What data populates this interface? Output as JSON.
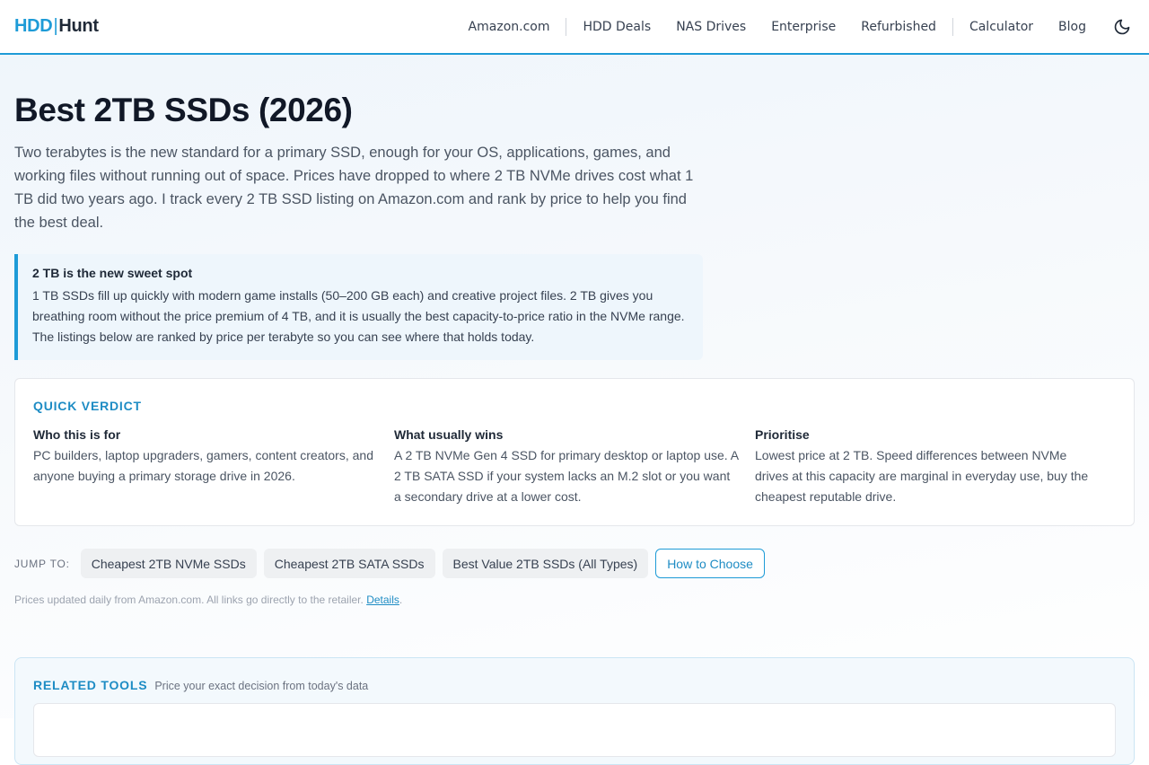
{
  "header": {
    "logo_part1": "HDD",
    "logo_sep": "|",
    "logo_part2": "Hunt",
    "nav": {
      "amazon": "Amazon.com",
      "hdd_deals": "HDD Deals",
      "nas_drives": "NAS Drives",
      "enterprise": "Enterprise",
      "refurbished": "Refurbished",
      "calculator": "Calculator",
      "blog": "Blog"
    },
    "theme_icon": "moon-icon"
  },
  "page": {
    "title": "Best 2TB SSDs (2026)",
    "intro": "Two terabytes is the new standard for a primary SSD, enough for your OS, applications, games, and working files without running out of space. Prices have dropped to where 2 TB NVMe drives cost what 1 TB did two years ago. I track every 2 TB SSD listing on Amazon.com and rank by price to help you find the best deal."
  },
  "callout": {
    "title": "2 TB is the new sweet spot",
    "body": "1 TB SSDs fill up quickly with modern game installs (50–200 GB each) and creative project files. 2 TB gives you breathing room without the price premium of 4 TB, and it is usually the best capacity-to-price ratio in the NVMe range. The listings below are ranked by price per terabyte so you can see where that holds today."
  },
  "verdict": {
    "heading": "QUICK VERDICT",
    "cols": [
      {
        "title": "Who this is for",
        "body": "PC builders, laptop upgraders, gamers, content creators, and anyone buying a primary storage drive in 2026."
      },
      {
        "title": "What usually wins",
        "body": "A 2 TB NVMe Gen 4 SSD for primary desktop or laptop use. A 2 TB SATA SSD if your system lacks an M.2 slot or you want a secondary drive at a lower cost."
      },
      {
        "title": "Prioritise",
        "body": "Lowest price at 2 TB. Speed differences between NVMe drives at this capacity are marginal in everyday use, buy the cheapest reputable drive."
      }
    ]
  },
  "jump": {
    "label": "JUMP TO:",
    "chips": [
      "Cheapest 2TB NVMe SSDs",
      "Cheapest 2TB SATA SSDs",
      "Best Value 2TB SSDs (All Types)",
      "How to Choose"
    ]
  },
  "updated": {
    "text": "Prices updated daily from Amazon.com. All links go directly to the retailer. ",
    "link": "Details",
    "end": "."
  },
  "related": {
    "title": "RELATED TOOLS",
    "subtitle": "Price your exact decision from today's data"
  },
  "colors": {
    "accent": "#1e9bd7",
    "accent_dark": "#1e8cc4",
    "text": "#1f2937"
  }
}
